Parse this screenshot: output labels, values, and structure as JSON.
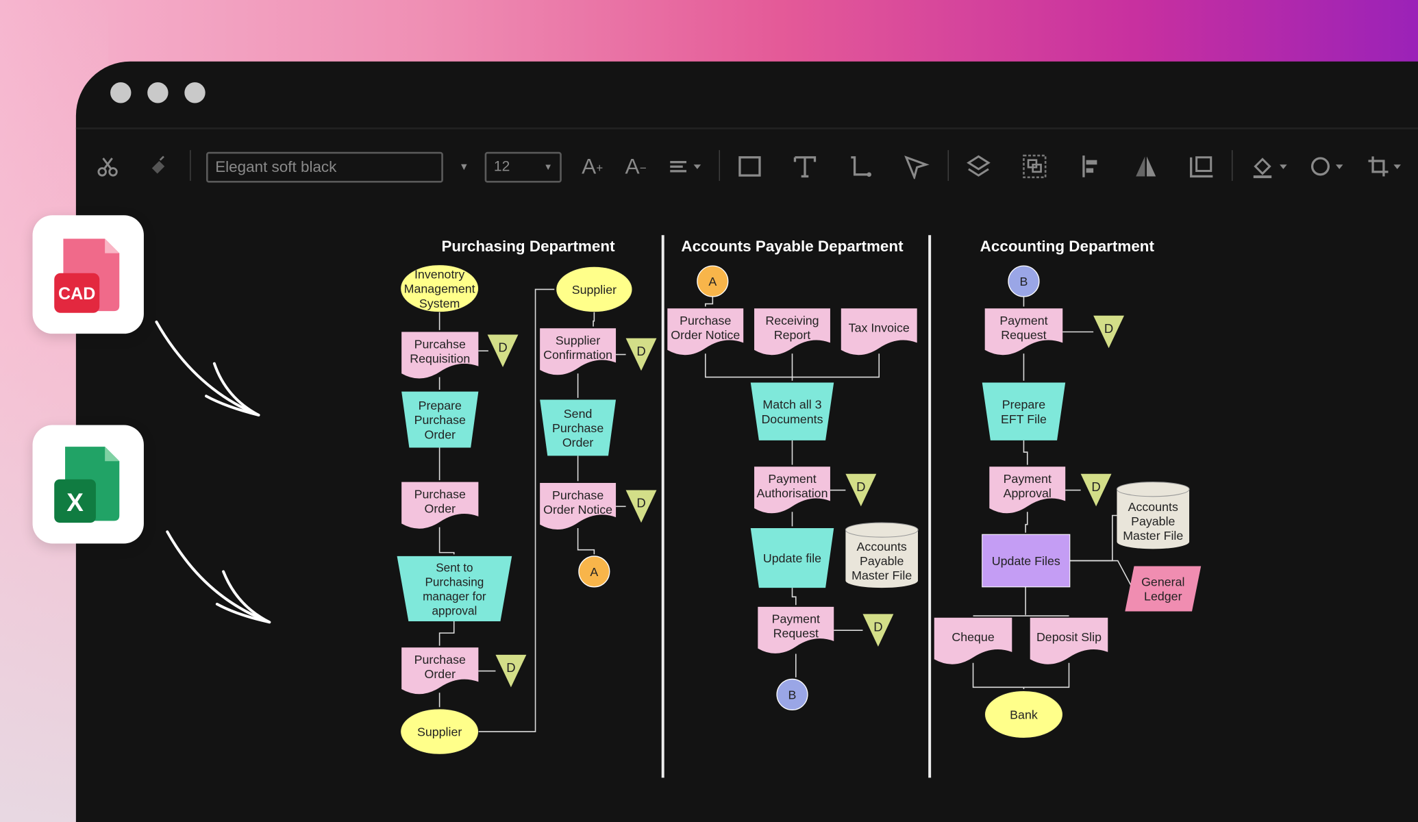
{
  "window": {
    "controls": [
      "close",
      "minimize",
      "maximize"
    ]
  },
  "toolbar": {
    "font_value": "Elegant soft black",
    "font_size_value": "12",
    "icons": [
      "scissors-icon",
      "format-painter-icon",
      "font-dropdown-icon",
      "increase-font-icon",
      "decrease-font-icon",
      "align-icon",
      "rectangle-icon",
      "text-icon",
      "connector-icon",
      "pointer-icon",
      "layers-icon",
      "group-icon",
      "align-left-icon",
      "flip-icon",
      "frame-icon",
      "fill-icon",
      "shape-style-icon",
      "crop-icon"
    ]
  },
  "side_apps": [
    {
      "label": "CAD",
      "color": "#e5364e"
    },
    {
      "label": "X",
      "color": "#1f8a4c"
    }
  ],
  "colors": {
    "document": "#f3c3dd",
    "process": "#7fe8da",
    "terminal": "#ffff8a",
    "triangle": "#d3de88",
    "connector_a": "#f8b54a",
    "connector_b": "#9aa6e6",
    "update_files": "#c49df4",
    "database": "#e9e5da",
    "ledger": "#f08db1"
  },
  "diagram": {
    "departments": [
      "Purchasing Department",
      "Accounts Payable Department",
      "Accounting Department"
    ],
    "nodes": [
      {
        "id": "n1",
        "type": "ellipse",
        "lines": [
          "Invenotry",
          "Management",
          "System"
        ]
      },
      {
        "id": "n2",
        "type": "doc",
        "lines": [
          "Purcahse",
          "Requisition"
        ]
      },
      {
        "id": "t1",
        "type": "tri",
        "lines": [
          "D"
        ]
      },
      {
        "id": "n3",
        "type": "trap",
        "lines": [
          "Prepare",
          "Purchase",
          "Order"
        ]
      },
      {
        "id": "n4",
        "type": "doc",
        "lines": [
          "Purchase",
          "Order"
        ]
      },
      {
        "id": "n5",
        "type": "trap",
        "lines": [
          "Sent to",
          "Purchasing",
          "manager for",
          "approval"
        ]
      },
      {
        "id": "n6",
        "type": "doc",
        "lines": [
          "Purchase",
          "Order"
        ]
      },
      {
        "id": "t2",
        "type": "tri",
        "lines": [
          "D"
        ]
      },
      {
        "id": "n7",
        "type": "ellipse",
        "lines": [
          "Supplier"
        ]
      },
      {
        "id": "n8",
        "type": "ellipse",
        "lines": [
          "Supplier"
        ]
      },
      {
        "id": "n9",
        "type": "doc",
        "lines": [
          "Supplier",
          "Confirmation"
        ]
      },
      {
        "id": "t3",
        "type": "tri",
        "lines": [
          "D"
        ]
      },
      {
        "id": "n10",
        "type": "trap",
        "lines": [
          "Send",
          "Purchase",
          "Order"
        ]
      },
      {
        "id": "n11",
        "type": "doc",
        "lines": [
          "Purchase",
          "Order Notice"
        ]
      },
      {
        "id": "t4",
        "type": "tri",
        "lines": [
          "D"
        ]
      },
      {
        "id": "c1",
        "type": "circleA",
        "lines": [
          "A"
        ]
      },
      {
        "id": "c2",
        "type": "circleA",
        "lines": [
          "A"
        ]
      },
      {
        "id": "a1",
        "type": "doc",
        "lines": [
          "Purchase",
          "Order Notice"
        ]
      },
      {
        "id": "a2",
        "type": "doc",
        "lines": [
          "Receiving",
          "Report"
        ]
      },
      {
        "id": "a3",
        "type": "doc",
        "lines": [
          "Tax Invoice"
        ]
      },
      {
        "id": "a4",
        "type": "trap",
        "lines": [
          "Match all 3",
          "Documents"
        ]
      },
      {
        "id": "a5",
        "type": "doc",
        "lines": [
          "Payment",
          "Authorisation"
        ]
      },
      {
        "id": "t5",
        "type": "tri",
        "lines": [
          "D"
        ]
      },
      {
        "id": "a6",
        "type": "trap",
        "lines": [
          "Update file"
        ]
      },
      {
        "id": "a7",
        "type": "cyl",
        "lines": [
          "Accounts",
          "Payable",
          "Master File"
        ]
      },
      {
        "id": "a8",
        "type": "doc",
        "lines": [
          "Payment",
          "Request"
        ]
      },
      {
        "id": "t6",
        "type": "tri",
        "lines": [
          "D"
        ]
      },
      {
        "id": "c3",
        "type": "circleB",
        "lines": [
          "B"
        ]
      },
      {
        "id": "c4",
        "type": "circleB",
        "lines": [
          "B"
        ]
      },
      {
        "id": "b1",
        "type": "doc",
        "lines": [
          "Payment",
          "Request"
        ]
      },
      {
        "id": "t7",
        "type": "tri",
        "lines": [
          "D"
        ]
      },
      {
        "id": "b2",
        "type": "trap",
        "lines": [
          "Prepare",
          "EFT File"
        ]
      },
      {
        "id": "b3",
        "type": "doc",
        "lines": [
          "Payment",
          "Approval"
        ]
      },
      {
        "id": "t8",
        "type": "tri",
        "lines": [
          "D"
        ]
      },
      {
        "id": "b4",
        "type": "cyl",
        "lines": [
          "Accounts",
          "Payable",
          "Master File"
        ]
      },
      {
        "id": "b5",
        "type": "rect",
        "lines": [
          "Update Files"
        ]
      },
      {
        "id": "b6",
        "type": "para",
        "lines": [
          "General",
          "Ledger"
        ]
      },
      {
        "id": "b7",
        "type": "doc",
        "lines": [
          "Cheque"
        ]
      },
      {
        "id": "b8",
        "type": "doc",
        "lines": [
          "Deposit Slip"
        ]
      },
      {
        "id": "b9",
        "type": "ellipse",
        "lines": [
          "Bank"
        ]
      }
    ]
  }
}
